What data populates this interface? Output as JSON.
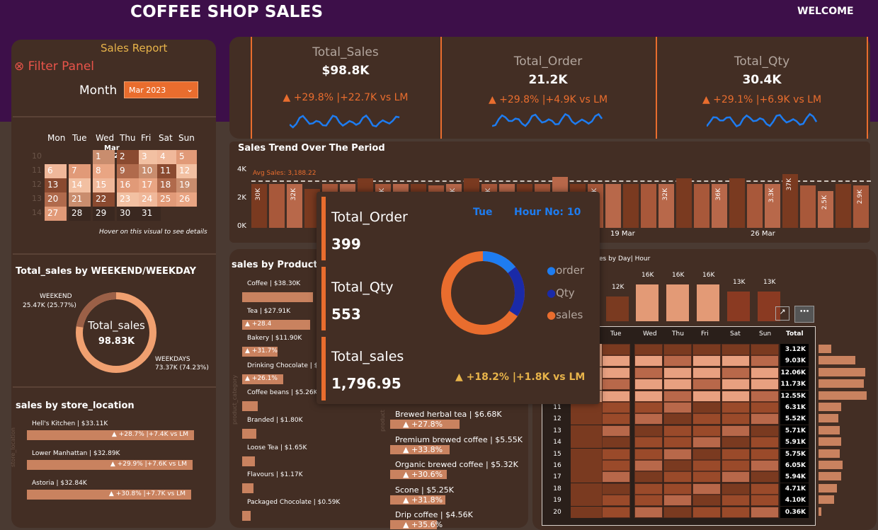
{
  "header": {
    "title": "COFFEE SHOP SALES",
    "welcome": "WELCOME"
  },
  "filter": {
    "report_label": "Sales Report",
    "panel_label": "Filter Panel",
    "month_label": "Month",
    "month_value": "Mar 2023"
  },
  "calendar": {
    "days": [
      "Mon",
      "Tue",
      "Wed",
      "Thu",
      "Fri",
      "Sat",
      "Sun"
    ],
    "month_title": "Mar 2023",
    "week_numbers": [
      "10",
      "11",
      "12",
      "13",
      "14"
    ],
    "hint": "Hover on this visual to see details",
    "dates": [
      "1",
      "2",
      "3",
      "4",
      "5",
      "6",
      "7",
      "8",
      "9",
      "10",
      "11",
      "12",
      "13",
      "14",
      "15",
      "16",
      "17",
      "18",
      "19",
      "20",
      "21",
      "22",
      "23",
      "24",
      "25",
      "26",
      "27",
      "28",
      "29",
      "30",
      "31"
    ]
  },
  "kpis": [
    {
      "title": "Total_Sales",
      "value": "$98.8K",
      "delta": "▲ +29.8% |+22.7K vs LM"
    },
    {
      "title": "Total_Order",
      "value": "21.2K",
      "delta": "▲ +29.8% |+4.9K vs LM"
    },
    {
      "title": "Total_Qty",
      "value": "30.4K",
      "delta": "▲ +29.1% |+6.9K vs LM"
    }
  ],
  "trend": {
    "title": "Sales Trend Over The Period",
    "avg_label": "Avg Sales: 3,188.22",
    "y_ticks": [
      "4K",
      "2K",
      "0K"
    ],
    "x_labels": [
      "19 Mar",
      "26 Mar"
    ],
    "bar_labels": [
      "30K",
      "32K",
      "3.5K",
      "1K",
      "36K",
      "3.4K",
      "32K",
      "36K",
      "3.3K",
      "37K",
      "2.5K",
      "2.9K"
    ]
  },
  "weekend": {
    "title": "Total_sales by WEEKEND/WEEKDAY",
    "center_label": "Total_sales",
    "center_value": "98.83K",
    "weekend_label": "WEEKEND",
    "weekend_value": "25.47K (25.77%)",
    "weekday_label": "WEEKDAYS",
    "weekday_value": "73.37K (74.23%)"
  },
  "store": {
    "title": "sales by store_location",
    "axis": "store_location",
    "items": [
      {
        "name": "Hell's Kitchen | $33.11K",
        "delta": "▲ +28.7% |+7.4K vs LM"
      },
      {
        "name": "Lower Manhattan | $32.89K",
        "delta": "▲ +29.9% |+7.6K vs LM"
      },
      {
        "name": "Astoria | $32.84K",
        "delta": "▲ +30.8% |+7.7K vs LM"
      }
    ]
  },
  "category": {
    "title": "sales by Product c",
    "axis": "product_category",
    "items": [
      {
        "name": "Coffee | $38.30K",
        "delta": ""
      },
      {
        "name": "Tea | $27.91K",
        "delta": "▲ +28.4"
      },
      {
        "name": "Bakery | $11.90K",
        "delta": "▲ +31.7%"
      },
      {
        "name": "Drinking Chocolate | $",
        "delta": "▲ +26.1%"
      },
      {
        "name": "Coffee beans | $5.26K",
        "delta": ""
      },
      {
        "name": "Branded | $1.80K",
        "delta": ""
      },
      {
        "name": "Loose Tea | $1.65K",
        "delta": ""
      },
      {
        "name": "Flavours | $1.17K",
        "delta": ""
      },
      {
        "name": "Packaged Chocolate | $0.59K",
        "delta": ""
      }
    ]
  },
  "product": {
    "axis": "product",
    "items": [
      {
        "name": "Brewed herbal tea | $6.68K",
        "delta": "▲ +27.8%"
      },
      {
        "name": "Premium brewed coffee | $5.55K",
        "delta": "▲ +33.8%"
      },
      {
        "name": "Organic brewed coffee | $5.32K",
        "delta": "▲ +30.6%"
      },
      {
        "name": "Scone | $5.25K",
        "delta": "▲ +31.8%"
      },
      {
        "name": "Drip coffee | $4.56K",
        "delta": "▲ +35.6%"
      }
    ]
  },
  "heatmap": {
    "title_fragment": "es by Day| Hour",
    "day_values": [
      "12K",
      "16K",
      "16K",
      "16K",
      "13K",
      "13K"
    ],
    "columns": [
      "Tue",
      "Wed",
      "Thu",
      "Fri",
      "Sat",
      "Sun",
      "Total"
    ],
    "hours": [
      "",
      "",
      "",
      "",
      "",
      "11",
      "12",
      "13",
      "14",
      "15",
      "16",
      "17",
      "18",
      "19",
      "20"
    ],
    "totals": [
      "3.12K",
      "9.03K",
      "12.06K",
      "11.73K",
      "12.55K",
      "6.31K",
      "5.52K",
      "5.71K",
      "5.91K",
      "5.75K",
      "6.05K",
      "5.94K",
      "4.71K",
      "4.10K",
      "0.36K"
    ]
  },
  "tooltip": {
    "day": "Tue",
    "hour": "Hour No: 10",
    "order_label": "Total_Order",
    "order_value": "399",
    "qty_label": "Total_Qty",
    "qty_value": "553",
    "sales_label": "Total_sales",
    "sales_value": "1,796.95",
    "delta": "▲ +18.2% |+1.8K vs LM",
    "legend": [
      "order",
      "Qty",
      "sales"
    ]
  },
  "colors": {
    "accent": "#e96d2e",
    "blue": "#1e7cf0",
    "navy": "#1a2aa8",
    "gold": "#e8b44a",
    "header": "#3d0f49"
  }
}
